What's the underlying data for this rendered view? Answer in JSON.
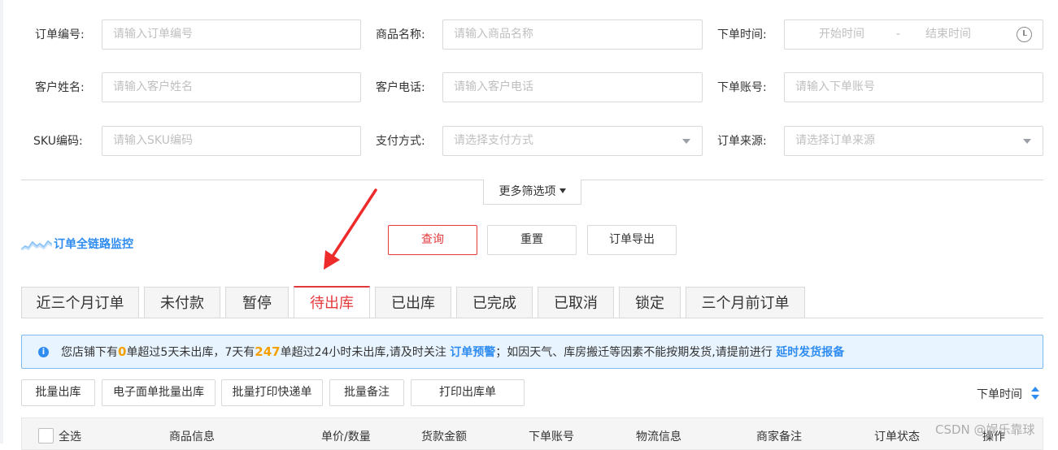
{
  "filters": {
    "order_no": {
      "label": "订单编号:",
      "placeholder": "请输入订单编号"
    },
    "product_name": {
      "label": "商品名称:",
      "placeholder": "请输入商品名称"
    },
    "order_time": {
      "label": "下单时间:",
      "start_placeholder": "开始时间",
      "separator": "-",
      "end_placeholder": "结束时间"
    },
    "customer_name": {
      "label": "客户姓名:",
      "placeholder": "请输入客户姓名"
    },
    "customer_phone": {
      "label": "客户电话:",
      "placeholder": "请输入客户电话"
    },
    "order_account": {
      "label": "下单账号:",
      "placeholder": "请输入下单账号"
    },
    "sku": {
      "label": "SKU编码:",
      "placeholder": "请输入SKU编码"
    },
    "payment": {
      "label": "支付方式:",
      "placeholder": "请选择支付方式"
    },
    "source": {
      "label": "订单来源:",
      "placeholder": "请选择订单来源"
    },
    "more_label": "更多筛选项"
  },
  "monitor_label": "订单全链路监控",
  "actions": {
    "query": "查询",
    "reset": "重置",
    "export": "订单导出"
  },
  "tabs": [
    "近三个月订单",
    "未付款",
    "暂停",
    "待出库",
    "已出库",
    "已完成",
    "已取消",
    "锁定",
    "三个月前订单"
  ],
  "active_tab": "待出库",
  "notice": {
    "p1": "您店铺下有",
    "count1": "0",
    "p2": "单超过5天未出库，7天有",
    "count2": "247",
    "p3": "单超过24小时未出库,请及时关注",
    "link1": "订单预警",
    "p4": "；如因天气、库房搬迁等因素不能按期发货,请提前进行",
    "link2": "延时发货报备"
  },
  "batch_actions": [
    "批量出库",
    "电子面单批量出库",
    "批量打印快递单",
    "批量备注",
    "打印出库单"
  ],
  "sort_label": "下单时间",
  "table_headers": [
    "全选",
    "商品信息",
    "单价/数量",
    "货款金额",
    "下单账号",
    "物流信息",
    "商家备注",
    "订单状态",
    "操作"
  ],
  "watermark": "CSDN @娱乐靠球",
  "colors": {
    "accent_red": "#e4393c",
    "link_blue": "#2f8cf0",
    "highlight_orange": "#f5a000",
    "arrow_red": "#ee2b2b"
  }
}
